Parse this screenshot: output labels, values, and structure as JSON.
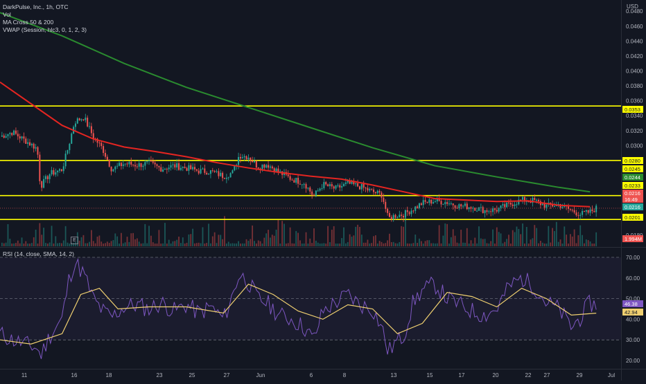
{
  "legend": {
    "title": "DarkPulse, Inc., 1h, OTC",
    "vol": "Vol",
    "ma": "MA Cross 50 & 200",
    "vwap": "VWAP (Session, hlc3, 0, 1, 2, 3)"
  },
  "rsi_legend": "RSI (14, close, SMA, 14, 2)",
  "e_badge": "E",
  "colors": {
    "background": "#131722",
    "up": "#26a69a",
    "down": "#ef5350",
    "ma50": "#e52521",
    "ma200": "#2a8b2f",
    "level": "#ffff00",
    "rsi": "#7e57c2",
    "rsi_ma": "#f0d070",
    "rsi_band": "#7e57c2"
  },
  "chart_data": [
    {
      "type": "candlestick",
      "title": "DarkPulse, Inc., 1h, OTC",
      "currency": "USD",
      "x_ticks": [
        "11",
        "16",
        "18",
        "23",
        "25",
        "27",
        "Jun",
        "6",
        "8",
        "13",
        "15",
        "17",
        "20",
        "22",
        "27",
        "29",
        "Jul"
      ],
      "y_ticks": [
        "0.0480",
        "0.0460",
        "0.0440",
        "0.0420",
        "0.0400",
        "0.0380",
        "0.0360",
        "0.0340",
        "0.0320",
        "0.0300",
        "0.0180"
      ],
      "ylim": [
        0.0165,
        0.0495
      ],
      "horizontal_levels": [
        0.0353,
        0.028,
        0.0233,
        0.0201
      ],
      "axis_labels": [
        {
          "text": "0.0353",
          "style": "level"
        },
        {
          "text": "0.0280",
          "style": "level"
        },
        {
          "text": "0.0245",
          "style": "level"
        },
        {
          "text": "0.0244",
          "style": "ma200"
        },
        {
          "text": "0.0233",
          "style": "level"
        },
        {
          "text": "0.0216",
          "style": "price"
        },
        {
          "text": "16:49",
          "style": "price"
        },
        {
          "text": "0.0216",
          "style": "vwap"
        },
        {
          "text": "0.0201",
          "style": "level"
        },
        {
          "text": "1.994M",
          "style": "volume"
        }
      ],
      "close_path": [
        [
          0,
          0.0312
        ],
        [
          0.02,
          0.0318
        ],
        [
          0.04,
          0.0307
        ],
        [
          0.06,
          0.0296
        ],
        [
          0.065,
          0.0245
        ],
        [
          0.08,
          0.0262
        ],
        [
          0.1,
          0.0268
        ],
        [
          0.11,
          0.0298
        ],
        [
          0.12,
          0.0332
        ],
        [
          0.135,
          0.0338
        ],
        [
          0.15,
          0.0312
        ],
        [
          0.165,
          0.0296
        ],
        [
          0.18,
          0.0268
        ],
        [
          0.2,
          0.0276
        ],
        [
          0.22,
          0.0274
        ],
        [
          0.24,
          0.0276
        ],
        [
          0.26,
          0.0269
        ],
        [
          0.28,
          0.0273
        ],
        [
          0.3,
          0.027
        ],
        [
          0.32,
          0.0266
        ],
        [
          0.34,
          0.0265
        ],
        [
          0.36,
          0.0259
        ],
        [
          0.375,
          0.0264
        ],
        [
          0.385,
          0.0287
        ],
        [
          0.4,
          0.0285
        ],
        [
          0.415,
          0.0272
        ],
        [
          0.43,
          0.0275
        ],
        [
          0.45,
          0.0264
        ],
        [
          0.47,
          0.0255
        ],
        [
          0.49,
          0.025
        ],
        [
          0.505,
          0.0232
        ],
        [
          0.52,
          0.0248
        ],
        [
          0.54,
          0.0242
        ],
        [
          0.56,
          0.0249
        ],
        [
          0.58,
          0.0245
        ],
        [
          0.6,
          0.0238
        ],
        [
          0.615,
          0.0234
        ],
        [
          0.625,
          0.0202
        ],
        [
          0.635,
          0.0206
        ],
        [
          0.65,
          0.0208
        ],
        [
          0.665,
          0.0215
        ],
        [
          0.68,
          0.0223
        ],
        [
          0.7,
          0.0226
        ],
        [
          0.72,
          0.0224
        ],
        [
          0.74,
          0.0219
        ],
        [
          0.76,
          0.0218
        ],
        [
          0.78,
          0.0213
        ],
        [
          0.8,
          0.0214
        ],
        [
          0.82,
          0.0221
        ],
        [
          0.84,
          0.0227
        ],
        [
          0.86,
          0.0226
        ],
        [
          0.88,
          0.0219
        ],
        [
          0.9,
          0.0221
        ],
        [
          0.92,
          0.0213
        ],
        [
          0.935,
          0.0208
        ],
        [
          0.95,
          0.0211
        ],
        [
          0.96,
          0.0216
        ]
      ],
      "series": [
        {
          "name": "MA 50",
          "points": [
            [
              0,
              0.0385
            ],
            [
              0.05,
              0.0356
            ],
            [
              0.1,
              0.0327
            ],
            [
              0.15,
              0.0309
            ],
            [
              0.2,
              0.0298
            ],
            [
              0.25,
              0.0292
            ],
            [
              0.3,
              0.0285
            ],
            [
              0.35,
              0.0277
            ],
            [
              0.4,
              0.027
            ],
            [
              0.45,
              0.0264
            ],
            [
              0.5,
              0.0259
            ],
            [
              0.55,
              0.0255
            ],
            [
              0.6,
              0.0247
            ],
            [
              0.65,
              0.0238
            ],
            [
              0.7,
              0.0229
            ],
            [
              0.75,
              0.0227
            ],
            [
              0.8,
              0.0225
            ],
            [
              0.85,
              0.0226
            ],
            [
              0.9,
              0.022
            ],
            [
              0.95,
              0.0218
            ]
          ]
        },
        {
          "name": "MA 200",
          "points": [
            [
              0,
              0.0478
            ],
            [
              0.1,
              0.0447
            ],
            [
              0.2,
              0.041
            ],
            [
              0.3,
              0.0378
            ],
            [
              0.4,
              0.0351
            ],
            [
              0.5,
              0.0324
            ],
            [
              0.6,
              0.0297
            ],
            [
              0.7,
              0.0273
            ],
            [
              0.8,
              0.0258
            ],
            [
              0.9,
              0.0244
            ],
            [
              0.95,
              0.0238
            ]
          ]
        }
      ]
    },
    {
      "type": "line",
      "title": "RSI (14, close, SMA, 14, 2)",
      "y_ticks": [
        "70.00",
        "60.00",
        "50.00",
        "40.00",
        "30.00",
        "20.00"
      ],
      "ylim": [
        16,
        74
      ],
      "bands": [
        70,
        50,
        30
      ],
      "current_values": [
        "46.38",
        "42.94"
      ],
      "series": [
        {
          "name": "RSI",
          "points": [
            [
              0,
              33
            ],
            [
              0.02,
              30
            ],
            [
              0.04,
              28
            ],
            [
              0.06,
              26
            ],
            [
              0.065,
              22
            ],
            [
              0.08,
              32
            ],
            [
              0.1,
              40
            ],
            [
              0.11,
              58
            ],
            [
              0.12,
              68
            ],
            [
              0.135,
              62
            ],
            [
              0.15,
              50
            ],
            [
              0.165,
              44
            ],
            [
              0.18,
              41
            ],
            [
              0.2,
              46
            ],
            [
              0.22,
              47
            ],
            [
              0.24,
              45
            ],
            [
              0.26,
              48
            ],
            [
              0.28,
              44
            ],
            [
              0.3,
              47
            ],
            [
              0.32,
              43
            ],
            [
              0.34,
              46
            ],
            [
              0.36,
              40
            ],
            [
              0.375,
              52
            ],
            [
              0.385,
              62
            ],
            [
              0.4,
              58
            ],
            [
              0.415,
              50
            ],
            [
              0.43,
              48
            ],
            [
              0.45,
              42
            ],
            [
              0.47,
              40
            ],
            [
              0.49,
              36
            ],
            [
              0.505,
              30
            ],
            [
              0.52,
              44
            ],
            [
              0.54,
              48
            ],
            [
              0.56,
              52
            ],
            [
              0.58,
              47
            ],
            [
              0.6,
              45
            ],
            [
              0.615,
              36
            ],
            [
              0.625,
              24
            ],
            [
              0.635,
              28
            ],
            [
              0.65,
              32
            ],
            [
              0.665,
              48
            ],
            [
              0.68,
              54
            ],
            [
              0.7,
              57
            ],
            [
              0.72,
              50
            ],
            [
              0.74,
              47
            ],
            [
              0.76,
              44
            ],
            [
              0.78,
              42
            ],
            [
              0.8,
              45
            ],
            [
              0.82,
              56
            ],
            [
              0.84,
              60
            ],
            [
              0.86,
              56
            ],
            [
              0.88,
              48
            ],
            [
              0.9,
              45
            ],
            [
              0.92,
              36
            ],
            [
              0.935,
              41
            ],
            [
              0.95,
              48
            ],
            [
              0.96,
              46.38
            ]
          ]
        },
        {
          "name": "RSI-based MA",
          "points": [
            [
              0,
              30
            ],
            [
              0.05,
              28
            ],
            [
              0.1,
              33
            ],
            [
              0.13,
              52
            ],
            [
              0.16,
              55
            ],
            [
              0.19,
              45
            ],
            [
              0.24,
              46
            ],
            [
              0.3,
              46
            ],
            [
              0.36,
              43
            ],
            [
              0.4,
              57
            ],
            [
              0.44,
              52
            ],
            [
              0.48,
              44
            ],
            [
              0.52,
              40
            ],
            [
              0.56,
              47
            ],
            [
              0.6,
              45
            ],
            [
              0.64,
              33
            ],
            [
              0.68,
              38
            ],
            [
              0.72,
              53
            ],
            [
              0.76,
              51
            ],
            [
              0.8,
              46
            ],
            [
              0.84,
              55
            ],
            [
              0.88,
              50
            ],
            [
              0.92,
              42
            ],
            [
              0.96,
              42.94
            ]
          ]
        }
      ]
    }
  ]
}
